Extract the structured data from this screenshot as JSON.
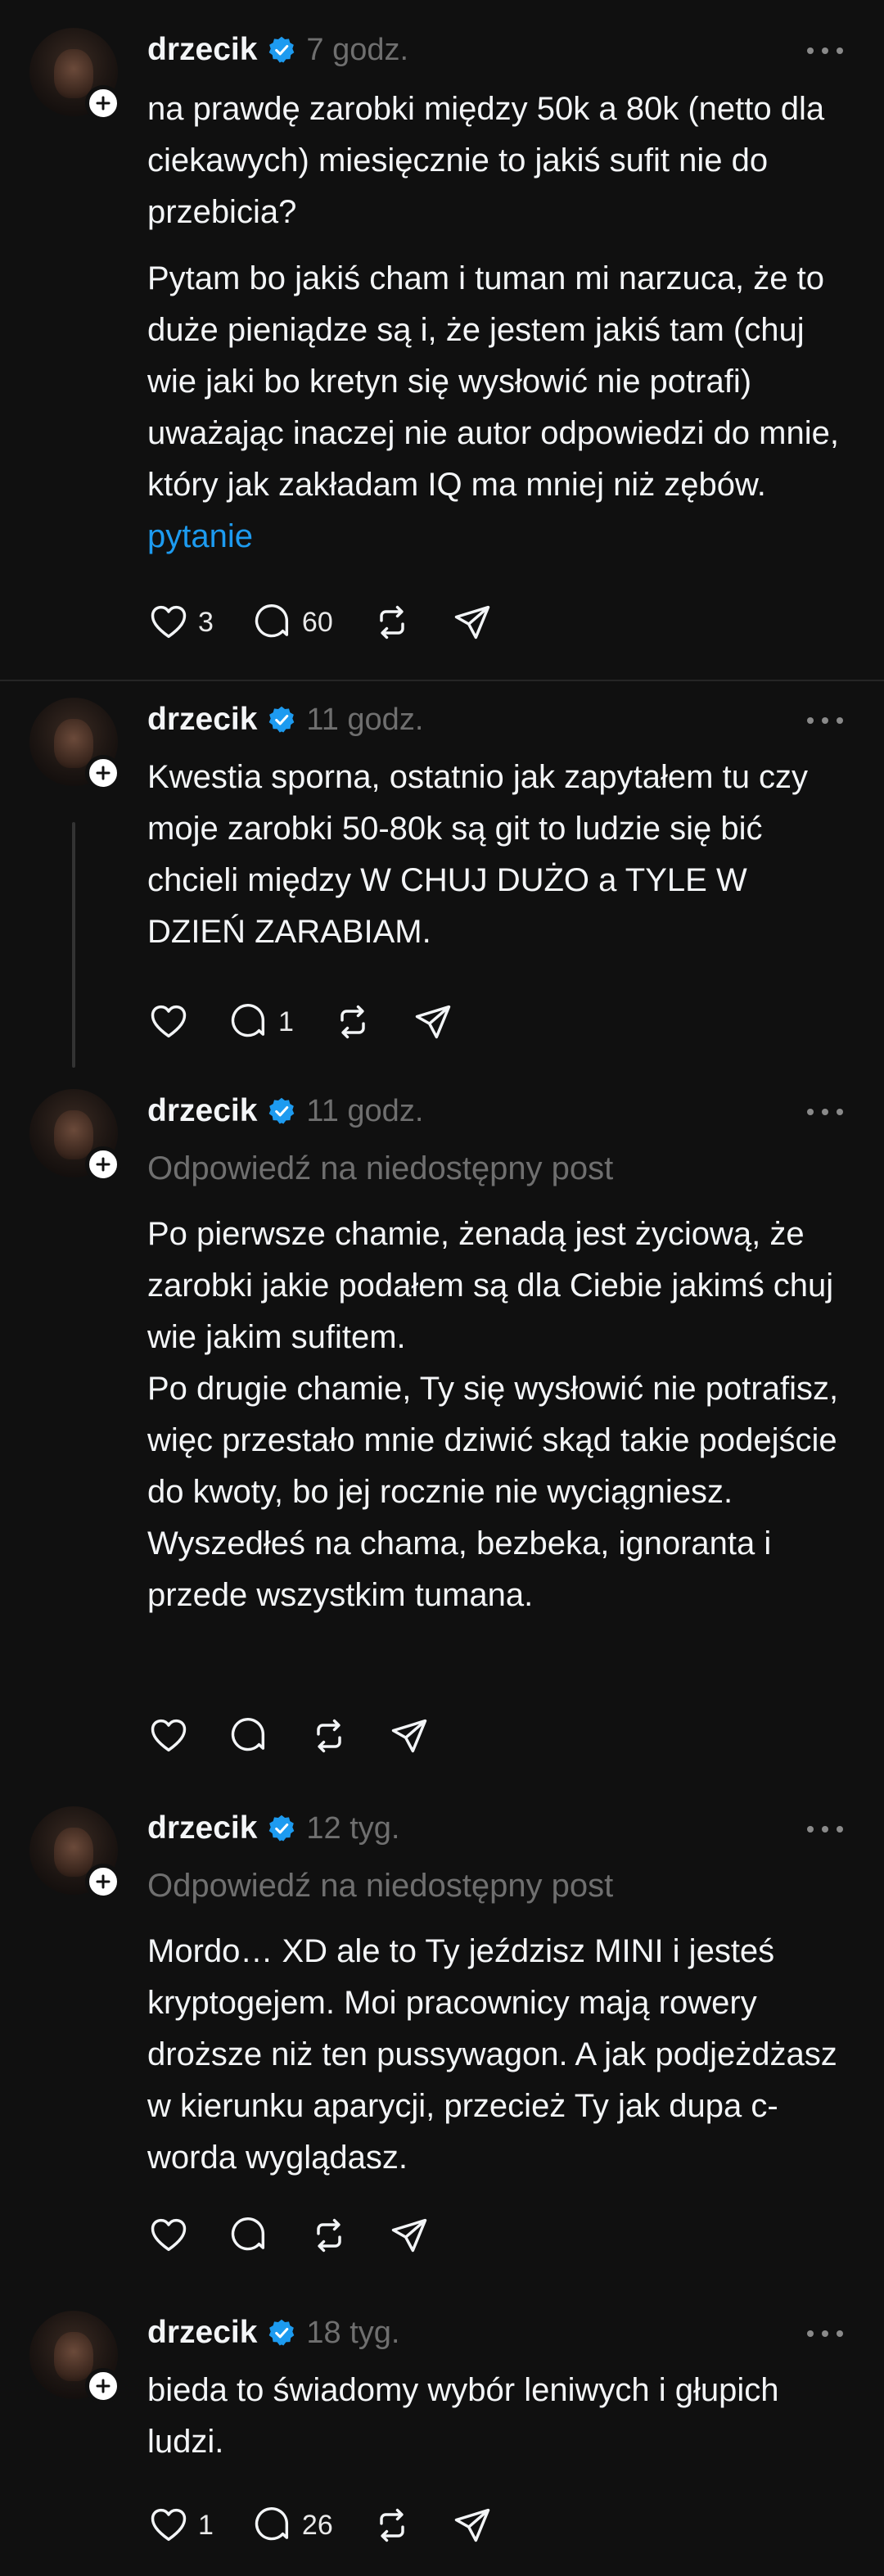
{
  "posts": [
    {
      "username": "drzecik",
      "time": "7 godz.",
      "paragraph1": "na prawdę zarobki między 50k a 80k (netto dla ciekawych) miesięcznie to jakiś sufit nie do przebicia?",
      "paragraph2": "Pytam bo jakiś cham i tuman mi narzuca, że to duże pieniądze są i, że jestem jakiś tam (chuj wie jaki bo kretyn się wysłowić nie potrafi) uważając inaczej nie autor odpowiedzi do mnie, który jak zakładam IQ ma mniej niż zębów.",
      "tag": "pytanie",
      "likes": "3",
      "replies": "60"
    },
    {
      "username": "drzecik",
      "time": "11 godz.",
      "text": "Kwestia sporna, ostatnio jak zapytałem tu czy moje zarobki 50-80k są git to ludzie się bić chcieli między W CHUJ DUŻO a TYLE W DZIEŃ ZARABIAM.",
      "likes": "",
      "replies": "1"
    },
    {
      "username": "drzecik",
      "time": "11 godz.",
      "reply_note": "Odpowiedź na niedostępny post",
      "text": "Po pierwsze chamie, żenadą jest życiową, że zarobki jakie podałem są dla Ciebie jakimś chuj wie jakim sufitem.\nPo drugie chamie, Ty się wysłowić nie potrafisz, więc przestało mnie dziwić skąd takie podejście do kwoty, bo jej rocznie nie wyciągniesz.\nWyszedłeś na chama, bezbeka, ignoranta i przede wszystkim tumana."
    },
    {
      "username": "drzecik",
      "time": "12 tyg.",
      "reply_note": "Odpowiedź na niedostępny post",
      "text": "Mordo… XD ale to Ty jeździsz MINI i jesteś kryptogejem. Moi pracownicy mają rowery droższe niż ten pussywagon. A jak podjeżdżasz w kierunku aparycji, przecież Ty jak dupa c-worda wyglądasz."
    },
    {
      "username": "drzecik",
      "time": "18 tyg.",
      "text": "bieda to świadomy wybór leniwych i głupich ludzi.",
      "likes": "1",
      "replies": "26"
    }
  ],
  "colors": {
    "background": "#101010",
    "text": "#f3f5f7",
    "muted": "#6f6f6f",
    "verified": "#1d9bf0",
    "link": "#1d9bf0"
  },
  "icons": [
    "heart-icon",
    "comment-icon",
    "repost-icon",
    "share-icon",
    "verified-icon",
    "more-icon",
    "follow-plus-icon"
  ]
}
